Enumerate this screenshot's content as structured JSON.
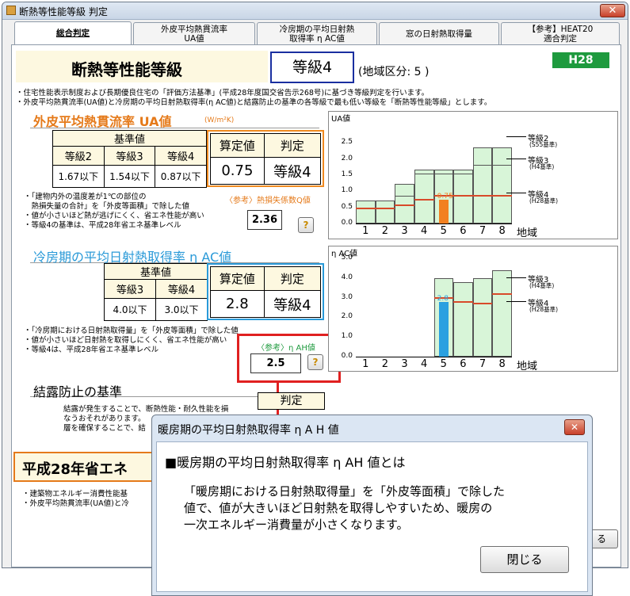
{
  "window": {
    "title": "断熱等性能等級 判定",
    "close": "✕"
  },
  "tabs": [
    "総合判定",
    "外皮平均熱貫流率\nUA値",
    "冷房期の平均日射熱\n取得率 η AC値",
    "窓の日射熱取得量",
    "【参考】HEAT20\n適合判定"
  ],
  "header": {
    "title": "断熱等性能等級",
    "grade": "等級4",
    "region": "(地域区分: 5 )",
    "badge": "H28"
  },
  "notes_top": [
    "・住宅性能表示制度および長期優良住宅の「評価方法基準」(平成28年度国交省告示268号)に基づき等級判定を行います。",
    "・外皮平均熱貫流率(UA値)と冷房期の平均日射熱取得率(η AC値)と結露防止の基準の各等級で最も低い等級を「断熱等性能等級」とします。"
  ],
  "ua": {
    "title": "外皮平均熱貫流率 UA値",
    "unit": "(W/m²K)",
    "std_label": "基準値",
    "grades": [
      "等級2",
      "等級3",
      "等級4"
    ],
    "values": [
      "1.67以下",
      "1.54以下",
      "0.87以下"
    ],
    "calc_label": "算定値",
    "judge_label": "判定",
    "calc": "0.75",
    "judge": "等級4",
    "notes": [
      "・「建物内外の温度差が1℃の部位の",
      "　熱損失量の合計」を「外皮等面積」で除した値",
      "・値が小さいほど熱が逃げにくく、省エネ性能が高い",
      "・等級4の基準は、平成28年省エネ基準レベル"
    ],
    "ref_label": "〈参考〉熱損失係数Q値",
    "q_value": "2.36",
    "help": "?"
  },
  "eta": {
    "title": "冷房期の平均日射熱取得率 η AC値",
    "std_label": "基準値",
    "grades": [
      "等級3",
      "等級4"
    ],
    "values": [
      "4.0以下",
      "3.0以下"
    ],
    "calc_label": "算定値",
    "judge_label": "判定",
    "calc": "2.8",
    "judge": "等級4",
    "notes": [
      "・「冷房期における日射熱取得量」を「外皮等面積」で除した値",
      "・値が小さいほど日射熱を取得しにくく、省エネ性能が高い",
      "・等級4は、平成28年省エネ基準レベル"
    ],
    "ref_label": "〈参考〉η AH値",
    "ah_value": "2.5",
    "help": "?"
  },
  "condensation": {
    "title": "結露防止の基準",
    "judge_label": "判定",
    "notes": [
      "結露が発生することで、断熱性能・耐久性能を損",
      "なうおそれがあります。",
      "層を確保することで、結"
    ]
  },
  "h28": {
    "title": "平成28年省エネ",
    "notes": [
      "・建築物エネルギー消費性能基",
      "・外皮平均熱貫流率(UA値)と冷"
    ]
  },
  "close_main": "る",
  "chart_data": [
    {
      "type": "bar",
      "title": "UA値",
      "categories": [
        "1",
        "2",
        "3",
        "4",
        "5",
        "6",
        "7",
        "8"
      ],
      "xlabel": "地域",
      "ylim": [
        0,
        3.0
      ],
      "yticks": [
        "0.0",
        "0.5",
        "1.0",
        "1.5",
        "2.0",
        "2.5"
      ],
      "series": [
        {
          "name": "等級2",
          "values": [
            0.72,
            0.72,
            0.87,
            1.67,
            1.67,
            1.67,
            2.35,
            2.35
          ]
        },
        {
          "name": "等級3",
          "values": [
            0.72,
            0.72,
            1.24,
            1.54,
            1.54,
            1.54,
            1.81,
            1.81
          ]
        },
        {
          "name": "等級4",
          "values": [
            0.46,
            0.46,
            0.56,
            0.75,
            0.87,
            0.87,
            0.87,
            0.87
          ]
        }
      ],
      "highlight": {
        "category": "5",
        "value": 0.75,
        "label": "0.75"
      },
      "legend": [
        {
          "name": "等級2",
          "sub": "(S55基準)"
        },
        {
          "name": "等級3",
          "sub": "(H4基準)"
        },
        {
          "name": "等級4",
          "sub": "(H28基準)"
        }
      ],
      "colors": {
        "bar": "#d8f5d8",
        "std": "#d84a2a",
        "highlight": "#f28020"
      }
    },
    {
      "type": "bar",
      "title": "η AC値",
      "categories": [
        "1",
        "2",
        "3",
        "4",
        "5",
        "6",
        "7",
        "8"
      ],
      "xlabel": "地域",
      "ylim": [
        0,
        5.0
      ],
      "yticks": [
        "0.0",
        "1.0",
        "2.0",
        "3.0",
        "4.0",
        "5.0"
      ],
      "series": [
        {
          "name": "等級3",
          "values": [
            null,
            null,
            null,
            null,
            4.0,
            3.8,
            4.0,
            4.4
          ]
        },
        {
          "name": "等級4",
          "values": [
            null,
            null,
            null,
            null,
            3.0,
            2.8,
            2.7,
            3.2
          ]
        }
      ],
      "highlight": {
        "category": "5",
        "value": 2.8,
        "label": "2.8"
      },
      "legend": [
        {
          "name": "等級3",
          "sub": "(H4基準)"
        },
        {
          "name": "等級4",
          "sub": "(H28基準)"
        }
      ],
      "colors": {
        "bar": "#d8f5d8",
        "std": "#d84a2a",
        "highlight": "#2aa0e0"
      }
    }
  ],
  "dialog": {
    "title": "暖房期の平均日射熱取得率 η A H 値",
    "heading": "■暖房期の平均日射熱取得率 η AH 値とは",
    "body": [
      "「暖房期における日射熱取得量」を「外皮等面積」で除した",
      "値で、値が大きいほど日射熱を取得しやすいため、暖房の",
      "一次エネルギー消費量が小さくなります。"
    ],
    "close_button": "閉じる",
    "close_x": "✕"
  },
  "annotation_color": "#e02020"
}
